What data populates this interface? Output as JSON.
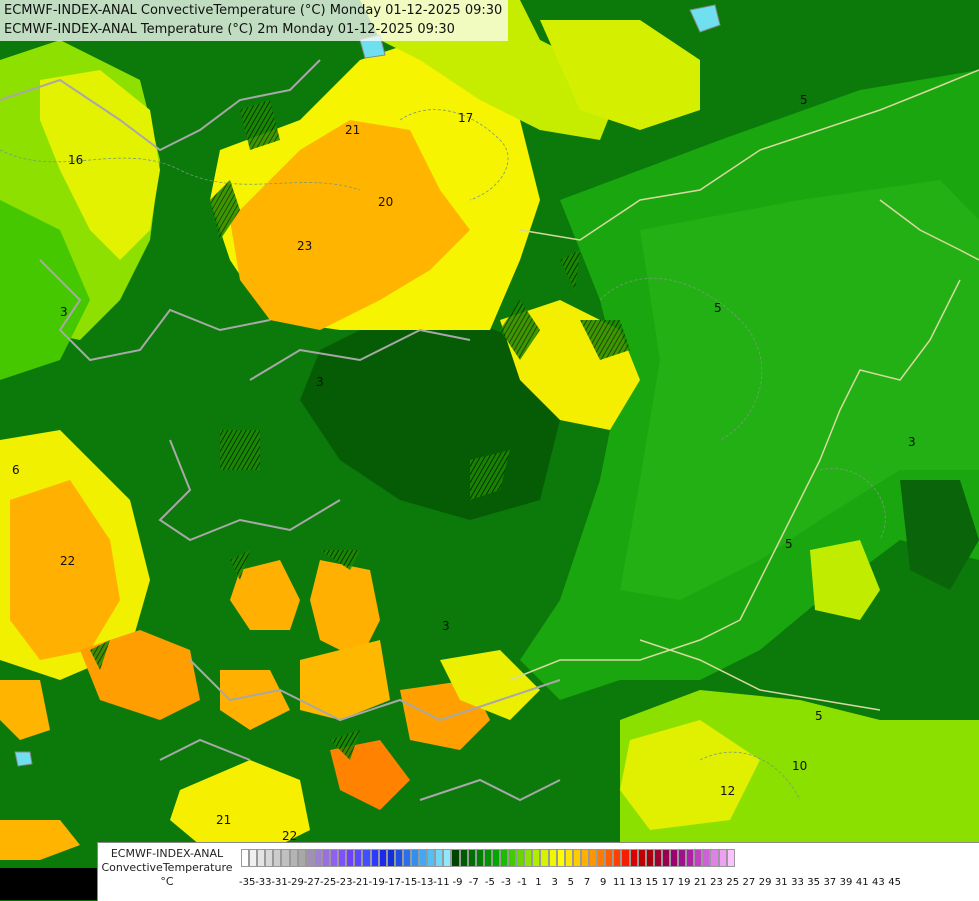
{
  "title": {
    "line1": "ECMWF-INDEX-ANAL ConvectiveTemperature (°C) Monday 01-12-2025 09:30",
    "line2": "ECMWF-INDEX-ANAL Temperature (°C) 2m Monday 01-12-2025 09:30"
  },
  "legend": {
    "label_line1": "ECMWF-INDEX-ANAL",
    "label_line2": "ConvectiveTemperature",
    "label_line3": "°C",
    "ticks": [
      "-35",
      "-33",
      "-31",
      "-29",
      "-27",
      "-25",
      "-23",
      "-21",
      "-19",
      "-17",
      "-15",
      "-13",
      "-11",
      "-9",
      "-7",
      "-5",
      "-3",
      "-1",
      "1",
      "3",
      "5",
      "7",
      "9",
      "11",
      "13",
      "15",
      "17",
      "19",
      "21",
      "23",
      "25",
      "27",
      "29",
      "31",
      "33",
      "35",
      "37",
      "39",
      "41",
      "43",
      "45"
    ],
    "colors": [
      "#ffffff",
      "#f0f0f0",
      "#e4e4e4",
      "#d8d8d8",
      "#cccccc",
      "#c0c0c0",
      "#b4b4b4",
      "#a8a8a8",
      "#a090b8",
      "#a080d0",
      "#9a70e0",
      "#9060f0",
      "#8050f8",
      "#7040ff",
      "#5a4aff",
      "#4050ff",
      "#2a3aff",
      "#1a2ae8",
      "#1030d8",
      "#2050e0",
      "#2a70ec",
      "#3090f0",
      "#40a8f4",
      "#50c0f8",
      "#70d8fa",
      "#90e8fc",
      "#004400",
      "#005a00",
      "#006e00",
      "#008000",
      "#009400",
      "#00a800",
      "#1cbc00",
      "#40cc00",
      "#66d800",
      "#8ce400",
      "#b0ee00",
      "#d4f400",
      "#f0f800",
      "#ffff00",
      "#ffe600",
      "#ffcc00",
      "#ffb000",
      "#ff9600",
      "#ff7a00",
      "#ff5e00",
      "#ff4000",
      "#f02000",
      "#d80000",
      "#c00000",
      "#a8000c",
      "#a00030",
      "#9a0050",
      "#9a0070",
      "#a0108a",
      "#b020a4",
      "#c040c0",
      "#d060d8",
      "#e080e8",
      "#f0a0f4",
      "#ffc0ff"
    ],
    "accent": "#00aa00"
  },
  "map": {
    "contour_labels": [
      "16",
      "21",
      "22",
      "20",
      "23",
      "17",
      "3",
      "5",
      "5",
      "3",
      "6",
      "3",
      "5",
      "10",
      "12",
      "21",
      "22",
      "5",
      "3"
    ]
  }
}
